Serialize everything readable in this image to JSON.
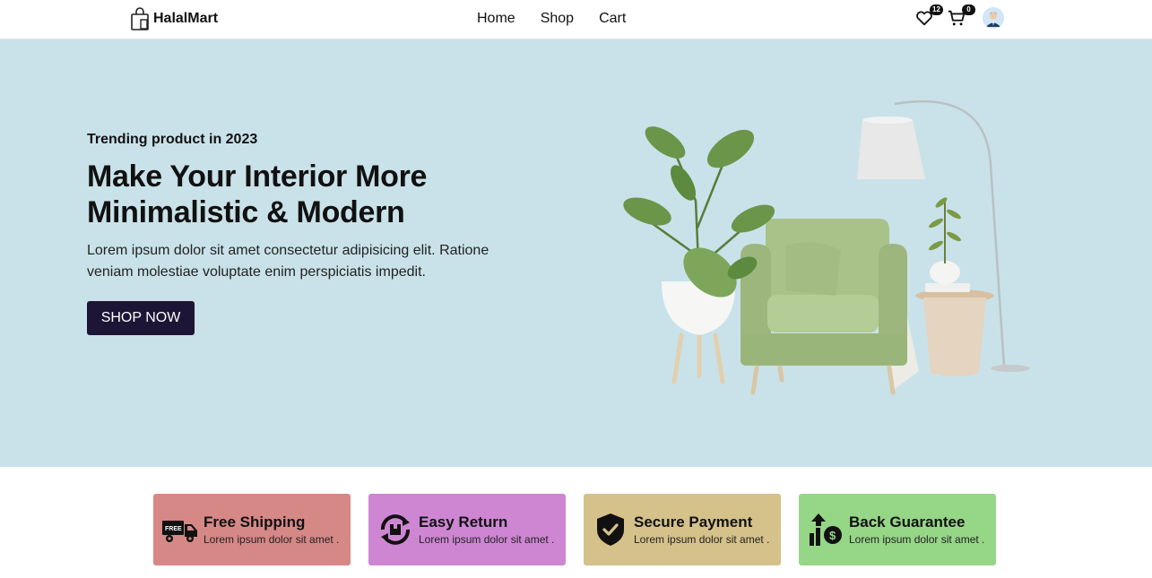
{
  "brand": {
    "name": "HalalMart"
  },
  "nav": {
    "links": [
      {
        "label": "Home"
      },
      {
        "label": "Shop"
      },
      {
        "label": "Cart"
      }
    ],
    "wishlist_count": "12",
    "cart_count": "0"
  },
  "hero": {
    "eyebrow": "Trending product in 2023",
    "headline_line1": "Make Your Interior More",
    "headline_line2": "Minimalistic & Modern",
    "body_line1": "Lorem ipsum dolor sit amet consectetur adipisicing elit. Ratione",
    "body_line2": "veniam molestiae voluptate enim perspiciatis impedit.",
    "cta_label": "SHOP NOW",
    "background": "#c9e2e9"
  },
  "features": [
    {
      "title": "Free Shipping",
      "subtitle": "Lorem ipsum dolor sit amet .",
      "color": "#d68886",
      "icon": "truck-icon"
    },
    {
      "title": "Easy Return",
      "subtitle": "Lorem ipsum dolor sit amet .",
      "color": "#ce86d3",
      "icon": "return-icon"
    },
    {
      "title": "Secure Payment",
      "subtitle": "Lorem ipsum dolor sit amet .",
      "color": "#d5c18a",
      "icon": "shield-icon"
    },
    {
      "title": "Back Guarantee",
      "subtitle": "Lorem ipsum dolor sit amet .",
      "color": "#96d687",
      "icon": "money-back-icon"
    }
  ]
}
